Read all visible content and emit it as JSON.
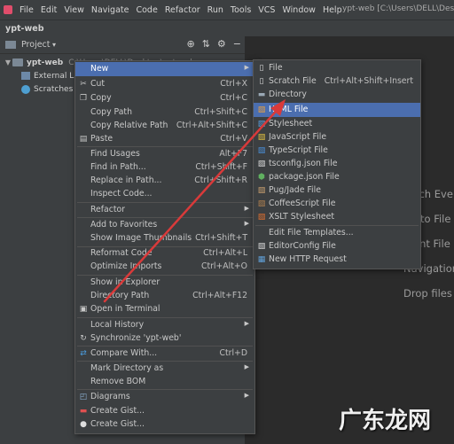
{
  "menubar": {
    "items": [
      "File",
      "Edit",
      "View",
      "Navigate",
      "Code",
      "Refactor",
      "Run",
      "Tools",
      "VCS",
      "Window",
      "Help"
    ],
    "window_title": "ypt-web [C:\\Users\\DELL\\Desk"
  },
  "breadcrumb": "ypt-web",
  "project_panel": {
    "title": "Project",
    "tree": [
      {
        "label": "ypt-web",
        "suffix": "C:\\Users\\DELL\\Desktop\\ypt-web"
      },
      {
        "label": "External Libr"
      },
      {
        "label": "Scratches an"
      }
    ]
  },
  "context_menu": [
    {
      "label": "New",
      "shortcut": "",
      "submenu": true,
      "selected": true
    },
    {
      "label": "Cut",
      "shortcut": "Ctrl+X",
      "icon": "scissors-icon"
    },
    {
      "label": "Copy",
      "shortcut": "Ctrl+C",
      "icon": "copy-icon"
    },
    {
      "label": "Copy Path",
      "shortcut": "Ctrl+Shift+C"
    },
    {
      "label": "Copy Relative Path",
      "shortcut": "Ctrl+Alt+Shift+C"
    },
    {
      "label": "Paste",
      "shortcut": "Ctrl+V",
      "icon": "clipboard-icon"
    },
    {
      "label": "Find Usages",
      "shortcut": "Alt+F7"
    },
    {
      "label": "Find in Path...",
      "shortcut": "Ctrl+Shift+F"
    },
    {
      "label": "Replace in Path...",
      "shortcut": "Ctrl+Shift+R"
    },
    {
      "label": "Inspect Code..."
    },
    {
      "label": "Refactor",
      "submenu": true
    },
    {
      "label": "Add to Favorites",
      "submenu": true
    },
    {
      "label": "Show Image Thumbnails",
      "shortcut": "Ctrl+Shift+T"
    },
    {
      "label": "Reformat Code",
      "shortcut": "Ctrl+Alt+L"
    },
    {
      "label": "Optimize Imports",
      "shortcut": "Ctrl+Alt+O"
    },
    {
      "label": "Show in Explorer"
    },
    {
      "label": "Directory Path",
      "shortcut": "Ctrl+Alt+F12"
    },
    {
      "label": "Open in Terminal",
      "icon": "terminal-icon"
    },
    {
      "label": "Local History",
      "submenu": true
    },
    {
      "label": "Synchronize 'ypt-web'",
      "icon": "sync-icon"
    },
    {
      "label": "Compare With...",
      "shortcut": "Ctrl+D",
      "icon": "compare-icon"
    },
    {
      "label": "Mark Directory as",
      "submenu": true
    },
    {
      "label": "Remove BOM"
    },
    {
      "label": "Diagrams",
      "submenu": true,
      "icon": "diagram-icon"
    },
    {
      "label": "Create Gist...",
      "icon": "gist-icon"
    },
    {
      "label": "Create Gist...",
      "icon": "github-icon"
    }
  ],
  "new_submenu": [
    {
      "label": "File",
      "icon": "file-icon"
    },
    {
      "label": "Scratch File",
      "shortcut": "Ctrl+Alt+Shift+Insert",
      "icon": "scratch-file-icon"
    },
    {
      "label": "Directory",
      "icon": "folder-icon"
    },
    {
      "label": "HTML File",
      "icon": "html-file-icon",
      "selected": true
    },
    {
      "label": "Stylesheet",
      "icon": "css-file-icon"
    },
    {
      "label": "JavaScript File",
      "icon": "js-file-icon"
    },
    {
      "label": "TypeScript File",
      "icon": "ts-file-icon"
    },
    {
      "label": "tsconfig.json File",
      "icon": "tsconfig-icon"
    },
    {
      "label": "package.json File",
      "icon": "package-json-icon"
    },
    {
      "label": "Pug/Jade File",
      "icon": "pug-file-icon"
    },
    {
      "label": "CoffeeScript File",
      "icon": "coffee-file-icon"
    },
    {
      "label": "XSLT Stylesheet",
      "icon": "xslt-file-icon"
    },
    {
      "label": "Edit File Templates...",
      "icon": ""
    },
    {
      "label": "EditorConfig File",
      "icon": "editorconfig-icon"
    },
    {
      "label": "New HTTP Request",
      "icon": "http-request-icon"
    }
  ],
  "editor_hints": [
    "rch Eve",
    "to File",
    "ent File",
    "Navigation",
    "Drop files"
  ],
  "watermark": "广东龙网",
  "colors": {
    "selection": "#4b6eaf",
    "menu_bg": "#3c3f41",
    "arrow": "#d93a3a"
  }
}
